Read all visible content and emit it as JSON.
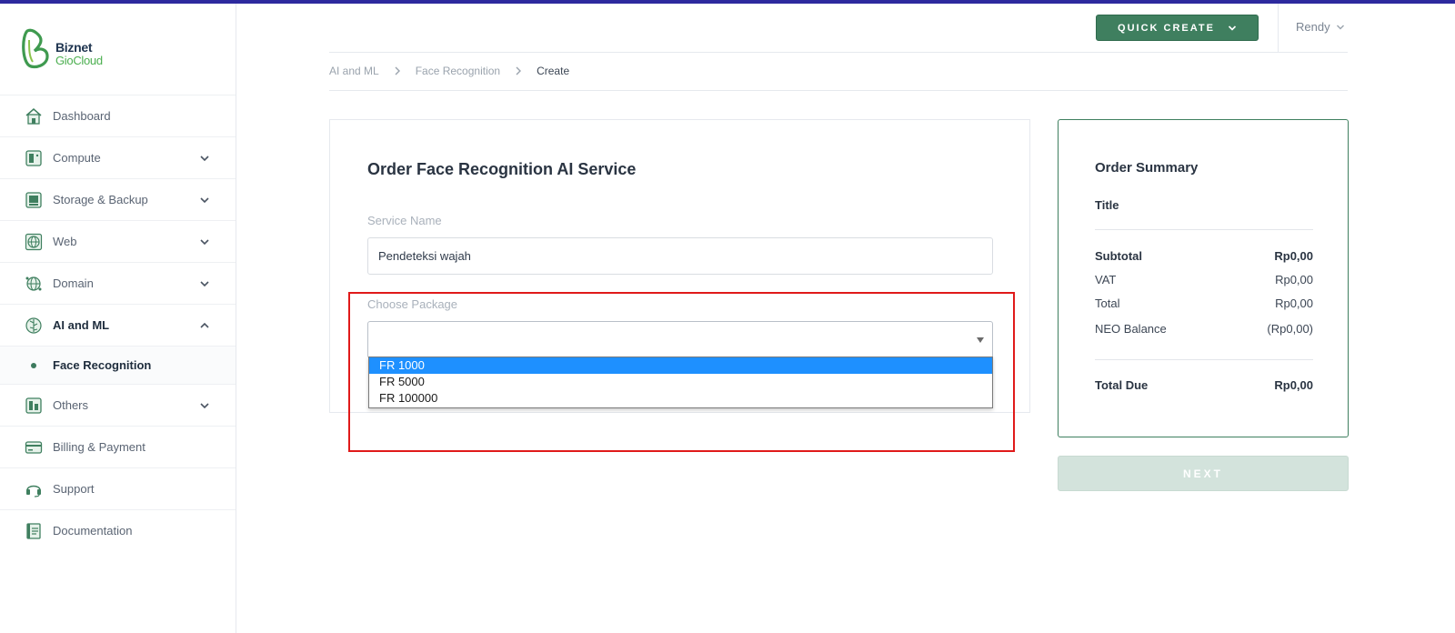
{
  "brand": {
    "name_line1": "Biznet",
    "name_line2": "GioCloud",
    "colors": {
      "primary": "#3f7f5f",
      "accent_top": "#2d2a9e",
      "highlight": "#e01a1a",
      "selection": "#1e90ff"
    }
  },
  "sidebar": {
    "items": [
      {
        "label": "Dashboard",
        "icon": "home-icon",
        "expandable": false
      },
      {
        "label": "Compute",
        "icon": "server-icon",
        "expandable": true
      },
      {
        "label": "Storage & Backup",
        "icon": "storage-icon",
        "expandable": true
      },
      {
        "label": "Web",
        "icon": "globe-icon",
        "expandable": true
      },
      {
        "label": "Domain",
        "icon": "domain-icon",
        "expandable": true
      },
      {
        "label": "AI and ML",
        "icon": "brain-icon",
        "expandable": true,
        "expanded": true
      },
      {
        "label": "Others",
        "icon": "others-icon",
        "expandable": true
      },
      {
        "label": "Billing & Payment",
        "icon": "card-icon",
        "expandable": false
      },
      {
        "label": "Support",
        "icon": "headset-icon",
        "expandable": false
      },
      {
        "label": "Documentation",
        "icon": "document-icon",
        "expandable": false
      }
    ],
    "sub_item": {
      "label": "Face Recognition"
    }
  },
  "header": {
    "quick_create_label": "QUICK CREATE",
    "user_name": "Rendy"
  },
  "breadcrumb": {
    "items": [
      "AI and ML",
      "Face Recognition",
      "Create"
    ]
  },
  "form": {
    "title": "Order Face Recognition AI Service",
    "service_name_label": "Service Name",
    "service_name_value": "Pendeteksi wajah",
    "package_label": "Choose Package",
    "package_value": "",
    "package_options": [
      "FR 1000",
      "FR 5000",
      "FR 100000"
    ],
    "package_highlighted_index": 0
  },
  "summary": {
    "title": "Order Summary",
    "subtitle": "Title",
    "rows": [
      {
        "label": "Subtotal",
        "value": "Rp0,00"
      },
      {
        "label": "VAT",
        "value": "Rp0,00"
      },
      {
        "label": "Total",
        "value": "Rp0,00"
      },
      {
        "label": "NEO Balance",
        "value": "(Rp0,00)"
      }
    ],
    "total_due_label": "Total Due",
    "total_due_value": "Rp0,00"
  },
  "next_label": "NEXT"
}
